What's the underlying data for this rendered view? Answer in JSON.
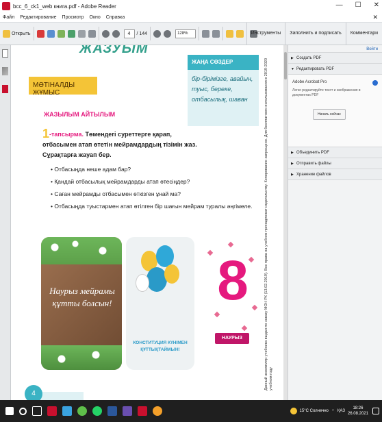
{
  "window": {
    "title": "bcc_6_ck1_web книга.pdf - Adobe Reader",
    "minimize": "—",
    "maximize": "☐",
    "close": "✕"
  },
  "menubar": {
    "items": [
      "Файл",
      "Редактирование",
      "Просмотр",
      "Окно",
      "Справка"
    ],
    "close_doc": "✕"
  },
  "toolbar": {
    "open_label": "Открыть",
    "page_current": "4",
    "page_total": "/ 144",
    "zoom": "128%",
    "tools_label": "Инструменты",
    "fill_sign_label": "Заполнить и подписать",
    "comment_label": "Комментари"
  },
  "right_pane": {
    "hide_label": "Войти",
    "sections": {
      "create_pdf": "Создать PDF",
      "edit_pdf": "Редактировать PDF",
      "combine_pdf": "Объединить PDF",
      "send_files": "Отправить файлы",
      "store_files": "Хранение файлов"
    },
    "product_name": "Adobe Acrobat Pro",
    "product_desc": "Легко редактируйте текст и изображения в документах PDF",
    "start_button": "Начать сейчас"
  },
  "document": {
    "page_title_fragment": "ЖАЗУЫМ",
    "section_label": "МӘТІНАЛДЫ ЖҰМЫС",
    "new_words_title": "ЖАҢА СӨЗДЕР",
    "new_words_body": "бір-бірімізге, авайын, туыс, береке, отбасылық, шаван",
    "activity_zhaz": "ЖАЗЫЛЫМ",
    "activity_aitylym": "АЙТЫЛЫМ",
    "task_number": "1",
    "task_label": "-тапсырма.",
    "task_text": "Төмендегі суреттерге қарап, отбасымен атап өтетін мейрамдардың тізімін жаз. Сұрақтарға жауап бер.",
    "bullets": [
      "• Отбасыңда неше адам бар?",
      "• Қандай отбасылық мейрамдарды атап өтесіңдер?",
      "• Саған мейрамды отбасымен өткізген ұнай ма?",
      "• Отбасыңда туыстармен атап өтілген бір шағын мейрам туралы әңгімеле."
    ],
    "image1_caption": "Наурыз мейрамы құтты болсын!",
    "image2_caption": "КОНСТИТУЦИЯ КҮНІМЕН ҚҰТТЫҚТАЙМЫН!",
    "image3_number": "8",
    "image3_banner": "НАУРЫЗ",
    "side_text": "Данный экземпляр учебника выдан по заказу МОН РК (13.02.2019). Все права на учебник принадлежат издательству. Копирование запрещено. Для бесплатного использования в 2019-2020 учебном году",
    "bottom_number": "4"
  },
  "taskbar": {
    "weather": "15°C Солнечно",
    "lang": "ҚАЗ",
    "time": "18:26",
    "date": "26.08.2021"
  }
}
